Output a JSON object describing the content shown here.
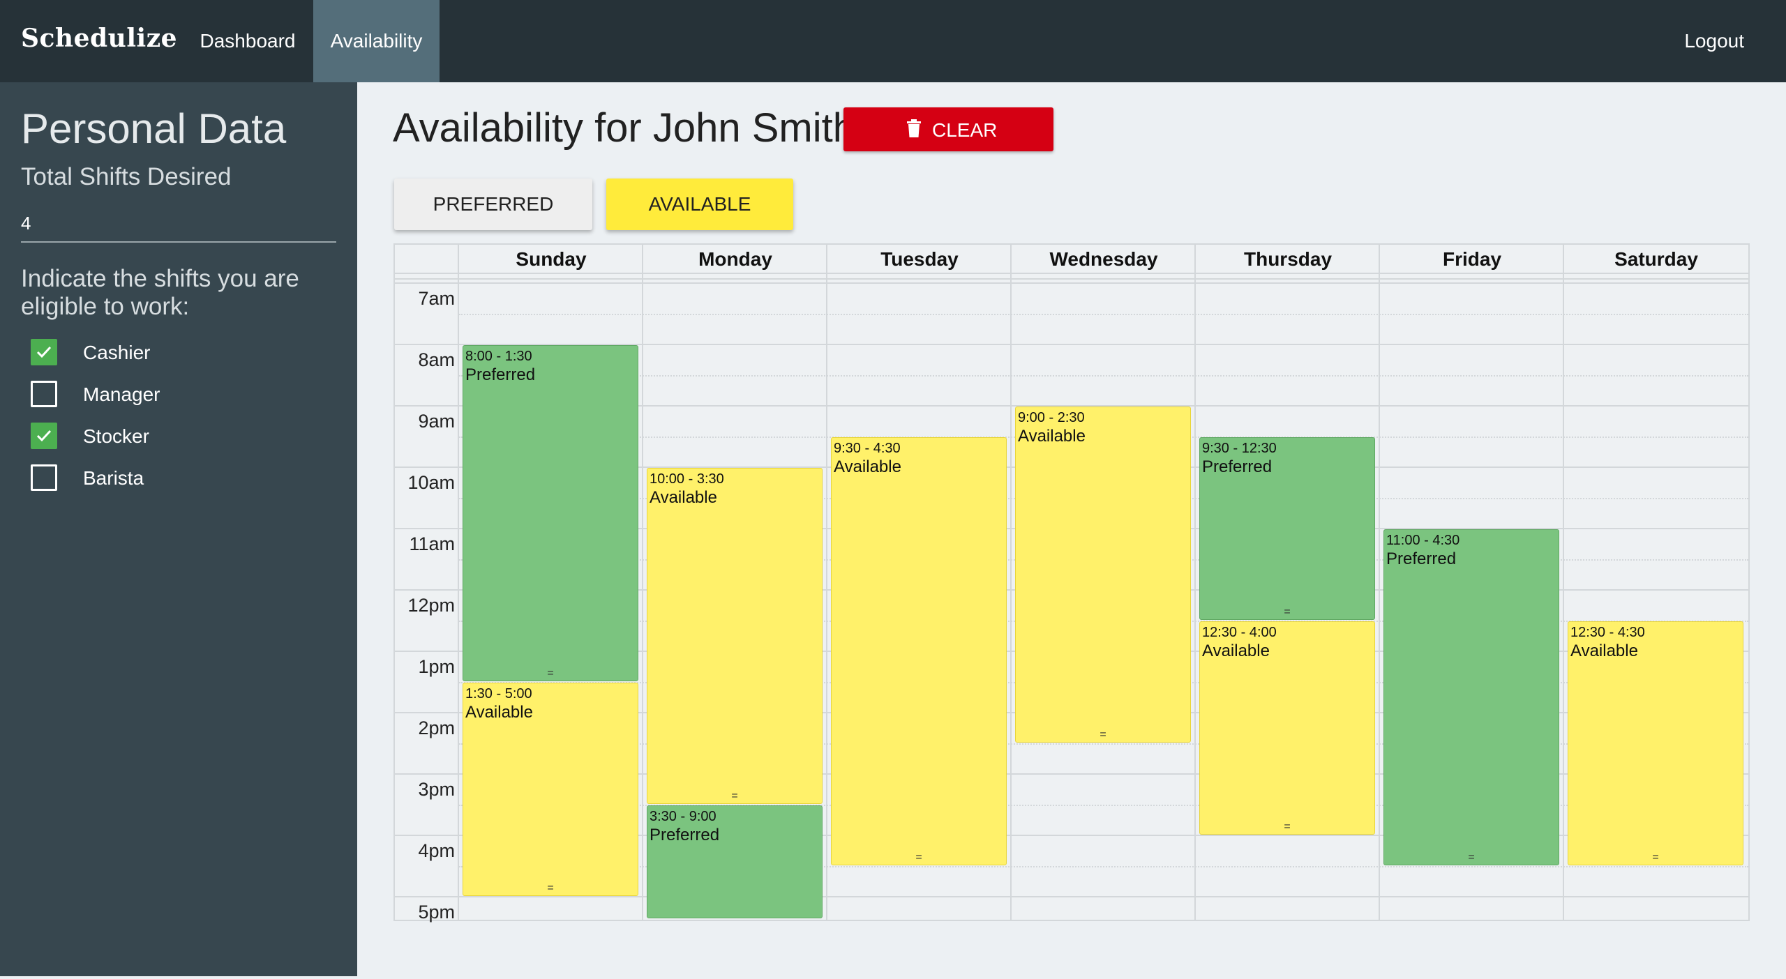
{
  "app": {
    "brand": "Schedulize"
  },
  "nav": {
    "dashboard": "Dashboard",
    "availability": "Availability",
    "logout": "Logout"
  },
  "sidebar": {
    "title": "Personal Data",
    "shifts_label": "Total Shifts Desired",
    "shifts_value": "4",
    "roles_prompt": "Indicate the shifts you are eligible to work:",
    "roles": [
      {
        "label": "Cashier",
        "checked": true
      },
      {
        "label": "Manager",
        "checked": false
      },
      {
        "label": "Stocker",
        "checked": true
      },
      {
        "label": "Barista",
        "checked": false
      }
    ]
  },
  "main": {
    "title": "Availability for John Smith",
    "clear_label": "CLEAR",
    "preferred_label": "PREFERRED",
    "available_label": "AVAILABLE"
  },
  "calendar": {
    "days": [
      "Sunday",
      "Monday",
      "Tuesday",
      "Wednesday",
      "Thursday",
      "Friday",
      "Saturday"
    ],
    "times": [
      "7am",
      "8am",
      "9am",
      "10am",
      "11am",
      "12pm",
      "1pm",
      "2pm",
      "3pm",
      "4pm",
      "5pm"
    ],
    "handle": "=",
    "events": [
      {
        "day": 0,
        "start": 8.0,
        "end": 13.5,
        "time": "8:00 - 1:30",
        "kind": "pref",
        "label": "Preferred"
      },
      {
        "day": 0,
        "start": 13.5,
        "end": 17.0,
        "time": "1:30 - 5:00",
        "kind": "avail",
        "label": "Available"
      },
      {
        "day": 1,
        "start": 10.0,
        "end": 15.5,
        "time": "10:00 - 3:30",
        "kind": "avail",
        "label": "Available"
      },
      {
        "day": 1,
        "start": 15.5,
        "end": 21.0,
        "time": "3:30 - 9:00",
        "kind": "pref",
        "label": "Preferred"
      },
      {
        "day": 2,
        "start": 9.5,
        "end": 16.5,
        "time": "9:30 - 4:30",
        "kind": "avail",
        "label": "Available"
      },
      {
        "day": 3,
        "start": 9.0,
        "end": 14.5,
        "time": "9:00 - 2:30",
        "kind": "avail",
        "label": "Available"
      },
      {
        "day": 4,
        "start": 9.5,
        "end": 12.5,
        "time": "9:30 - 12:30",
        "kind": "pref",
        "label": "Preferred"
      },
      {
        "day": 4,
        "start": 12.5,
        "end": 16.0,
        "time": "12:30 - 4:00",
        "kind": "avail",
        "label": "Available"
      },
      {
        "day": 5,
        "start": 11.0,
        "end": 16.5,
        "time": "11:00 - 4:30",
        "kind": "pref",
        "label": "Preferred"
      },
      {
        "day": 6,
        "start": 12.5,
        "end": 16.5,
        "time": "12:30 - 4:30",
        "kind": "avail",
        "label": "Available"
      }
    ]
  },
  "colors": {
    "preferred": "#7bc47f",
    "available": "#fff16a",
    "clear": "#d50013",
    "nav": "#263238",
    "sidebar": "#37474f"
  }
}
